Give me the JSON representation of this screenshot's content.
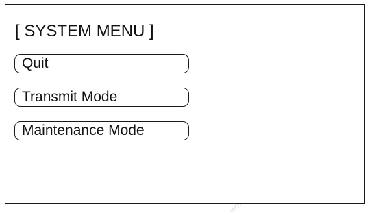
{
  "menu": {
    "title": "[ SYSTEM MENU ]",
    "items": [
      {
        "label": "Quit"
      },
      {
        "label": "Transmit Mode"
      },
      {
        "label": "Maintenance Mode"
      }
    ]
  },
  "watermark": {
    "text": "www.rgbautomatyka.pl",
    "text_short": "www.rgbautomatyka"
  },
  "colors": {
    "background": "#ffffff",
    "border": "#1a1a1a",
    "text": "#111111"
  }
}
